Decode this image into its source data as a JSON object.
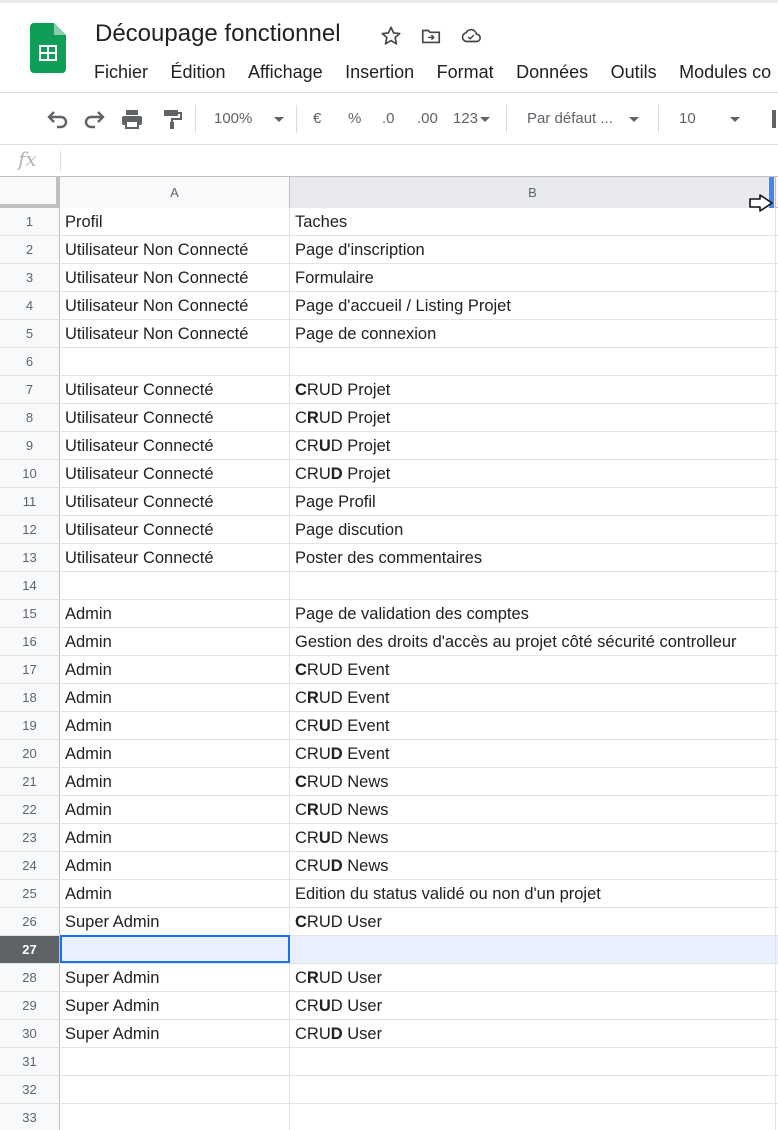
{
  "app": {
    "doc_title": "Découpage fonctionnel",
    "menu": [
      "Fichier",
      "Édition",
      "Affichage",
      "Insertion",
      "Format",
      "Données",
      "Outils",
      "Modules co"
    ]
  },
  "toolbar": {
    "zoom": "100%",
    "currency": "€",
    "percent": "%",
    "decrease_decimals": ".0",
    "increase_decimals": ".00",
    "more_formats": "123",
    "font": "Par défaut ...",
    "font_size": "10"
  },
  "formula_bar": {
    "fx_label": "fx",
    "value": ""
  },
  "columns": [
    "A",
    "B"
  ],
  "selected_row": 27,
  "rows": [
    {
      "n": "1",
      "a": "Profil",
      "b_pre": "Taches",
      "b_bold": "",
      "b_post": ""
    },
    {
      "n": "2",
      "a": "Utilisateur Non Connecté",
      "b_pre": "Page d'inscription",
      "b_bold": "",
      "b_post": ""
    },
    {
      "n": "3",
      "a": "Utilisateur Non Connecté",
      "b_pre": "Formulaire",
      "b_bold": "",
      "b_post": ""
    },
    {
      "n": "4",
      "a": "Utilisateur Non Connecté",
      "b_pre": "Page d'accueil / Listing Projet",
      "b_bold": "",
      "b_post": ""
    },
    {
      "n": "5",
      "a": "Utilisateur Non Connecté",
      "b_pre": "Page de connexion",
      "b_bold": "",
      "b_post": ""
    },
    {
      "n": "6",
      "a": "",
      "b_pre": "",
      "b_bold": "",
      "b_post": ""
    },
    {
      "n": "7",
      "a": "Utilisateur  Connecté",
      "b_pre": "",
      "b_bold": "C",
      "b_post": "RUD Projet"
    },
    {
      "n": "8",
      "a": "Utilisateur  Connecté",
      "b_pre": "C",
      "b_bold": "R",
      "b_post": "UD Projet"
    },
    {
      "n": "9",
      "a": "Utilisateur  Connecté",
      "b_pre": "CR",
      "b_bold": "U",
      "b_post": "D Projet"
    },
    {
      "n": "10",
      "a": "Utilisateur  Connecté",
      "b_pre": "CRU",
      "b_bold": "D",
      "b_post": " Projet"
    },
    {
      "n": "11",
      "a": "Utilisateur  Connecté",
      "b_pre": "Page Profil",
      "b_bold": "",
      "b_post": ""
    },
    {
      "n": "12",
      "a": "Utilisateur  Connecté",
      "b_pre": "Page discution",
      "b_bold": "",
      "b_post": ""
    },
    {
      "n": "13",
      "a": "Utilisateur  Connecté",
      "b_pre": "Poster des commentaires",
      "b_bold": "",
      "b_post": ""
    },
    {
      "n": "14",
      "a": "",
      "b_pre": "",
      "b_bold": "",
      "b_post": ""
    },
    {
      "n": "15",
      "a": "Admin",
      "b_pre": "Page de validation des comptes",
      "b_bold": "",
      "b_post": ""
    },
    {
      "n": "16",
      "a": "Admin",
      "b_pre": "Gestion des droits d'accès au projet côté sécurité controlleur",
      "b_bold": "",
      "b_post": ""
    },
    {
      "n": "17",
      "a": "Admin",
      "b_pre": "",
      "b_bold": "C",
      "b_post": "RUD Event"
    },
    {
      "n": "18",
      "a": "Admin",
      "b_pre": "C",
      "b_bold": "R",
      "b_post": "UD Event"
    },
    {
      "n": "19",
      "a": "Admin",
      "b_pre": "CR",
      "b_bold": "U",
      "b_post": "D Event"
    },
    {
      "n": "20",
      "a": "Admin",
      "b_pre": "CRU",
      "b_bold": "D",
      "b_post": " Event"
    },
    {
      "n": "21",
      "a": "Admin",
      "b_pre": "",
      "b_bold": "C",
      "b_post": "RUD News"
    },
    {
      "n": "22",
      "a": "Admin",
      "b_pre": "C",
      "b_bold": "R",
      "b_post": "UD News"
    },
    {
      "n": "23",
      "a": "Admin",
      "b_pre": "CR",
      "b_bold": "U",
      "b_post": "D News"
    },
    {
      "n": "24",
      "a": "Admin",
      "b_pre": "CRU",
      "b_bold": "D",
      "b_post": " News"
    },
    {
      "n": "25",
      "a": "Admin",
      "b_pre": "Edition du status validé ou non d'un projet",
      "b_bold": "",
      "b_post": ""
    },
    {
      "n": "26",
      "a": "Super Admin",
      "b_pre": "",
      "b_bold": "C",
      "b_post": "RUD User"
    },
    {
      "n": "27",
      "a": "",
      "b_pre": "",
      "b_bold": "",
      "b_post": ""
    },
    {
      "n": "28",
      "a": "Super Admin",
      "b_pre": "C",
      "b_bold": "R",
      "b_post": "UD User"
    },
    {
      "n": "29",
      "a": "Super Admin",
      "b_pre": "CR",
      "b_bold": "U",
      "b_post": "D User"
    },
    {
      "n": "30",
      "a": "Super Admin",
      "b_pre": "CRU",
      "b_bold": "D",
      "b_post": " User"
    },
    {
      "n": "31",
      "a": "",
      "b_pre": "",
      "b_bold": "",
      "b_post": ""
    },
    {
      "n": "32",
      "a": "",
      "b_pre": "",
      "b_bold": "",
      "b_post": ""
    },
    {
      "n": "33",
      "a": "",
      "b_pre": "",
      "b_bold": "",
      "b_post": ""
    }
  ],
  "colors": {
    "sheets_green": "#0f9d58",
    "selection_blue": "#1a73e8",
    "selected_row_bg": "#e8f0fe"
  },
  "icons": [
    "sheets-logo-icon",
    "star-icon",
    "move-to-folder-icon",
    "cloud-saved-icon",
    "undo-icon",
    "redo-icon",
    "print-icon",
    "paint-format-icon",
    "pointer-cursor-icon"
  ]
}
